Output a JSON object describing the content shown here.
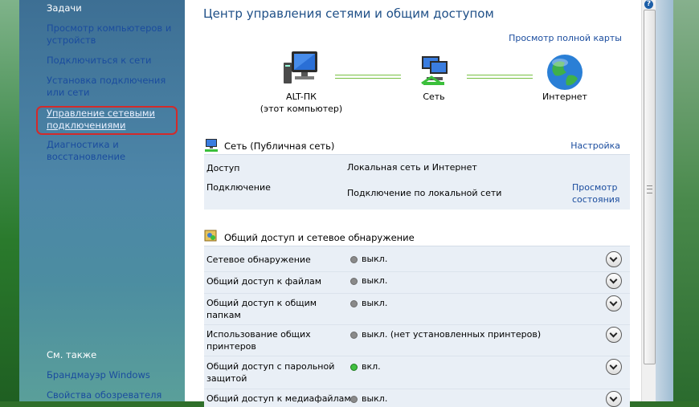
{
  "sidebar": {
    "tasks_heading": "Задачи",
    "items": [
      {
        "label": "Просмотр компьютеров и устройств"
      },
      {
        "label": "Подключиться к сети"
      },
      {
        "label": "Установка подключения или сети"
      },
      {
        "label": "Управление сетевыми подключениями"
      },
      {
        "label": "Диагностика и восстановление"
      }
    ],
    "see_also": "См. также",
    "see_also_items": [
      {
        "label": "Брандмауэр Windows"
      },
      {
        "label": "Свойства обозревателя"
      }
    ]
  },
  "main": {
    "title": "Центр управления сетями и общим доступом",
    "full_map_link": "Просмотр полной карты",
    "map": {
      "computer_name": "ALT-ПК",
      "computer_sub": "(этот компьютер)",
      "network": "Сеть",
      "internet": "Интернет"
    },
    "network_section": {
      "title": "Сеть (Публичная сеть)",
      "settings_link": "Настройка",
      "rows": [
        {
          "label": "Доступ",
          "value": "Локальная сеть и Интернет"
        },
        {
          "label": "Подключение",
          "value": "Подключение по локальной сети",
          "link": "Просмотр состояния"
        }
      ]
    },
    "sharing_section": {
      "title": "Общий доступ и сетевое обнаружение",
      "rows": [
        {
          "label": "Сетевое обнаружение",
          "status": "выкл.",
          "on": false
        },
        {
          "label": "Общий доступ к файлам",
          "status": "выкл.",
          "on": false
        },
        {
          "label": "Общий доступ к общим папкам",
          "status": "выкл.",
          "on": false
        },
        {
          "label": "Использование общих принтеров",
          "status": "выкл. (нет установленных принтеров)",
          "on": false
        },
        {
          "label": "Общий доступ с парольной защитой",
          "status": "вкл.",
          "on": true
        },
        {
          "label": "Общий доступ к медиафайлам",
          "status": "выкл.",
          "on": false
        }
      ]
    }
  },
  "colors": {
    "link": "#1a4c9e",
    "title": "#1e4f87",
    "status_on": "#40c040",
    "status_off": "#8a8a8a",
    "highlight": "#d32a2a"
  }
}
